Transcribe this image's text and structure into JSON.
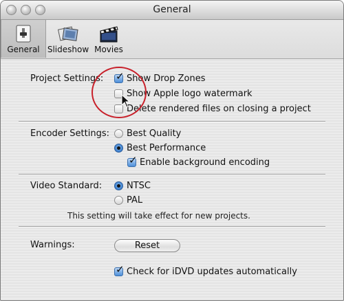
{
  "window": {
    "title": "General"
  },
  "toolbar": {
    "items": [
      {
        "label": "General",
        "icon": "general-prefs-icon",
        "selected": true
      },
      {
        "label": "Slideshow",
        "icon": "slideshow-icon",
        "selected": false
      },
      {
        "label": "Movies",
        "icon": "movies-clapboard-icon",
        "selected": false
      }
    ]
  },
  "project": {
    "label": "Project Settings:",
    "options": [
      {
        "label": "Show Drop Zones",
        "checked": true
      },
      {
        "label": "Show Apple logo watermark",
        "checked": false
      },
      {
        "label": "Delete rendered files on closing a project",
        "checked": false
      }
    ]
  },
  "encoder": {
    "label": "Encoder Settings:",
    "options": [
      {
        "label": "Best Quality",
        "selected": false
      },
      {
        "label": "Best Performance",
        "selected": true
      }
    ],
    "background": {
      "label": "Enable background encoding",
      "checked": true
    }
  },
  "video": {
    "label": "Video Standard:",
    "options": [
      {
        "label": "NTSC",
        "selected": true
      },
      {
        "label": "PAL",
        "selected": false
      }
    ],
    "note": "This setting will take effect for new projects."
  },
  "warnings": {
    "label": "Warnings:",
    "reset_label": "Reset",
    "updates": {
      "label": "Check for iDVD updates automatically",
      "checked": true
    }
  },
  "colors": {
    "accent": "#4d8fd9",
    "annotation": "#c8202a"
  }
}
